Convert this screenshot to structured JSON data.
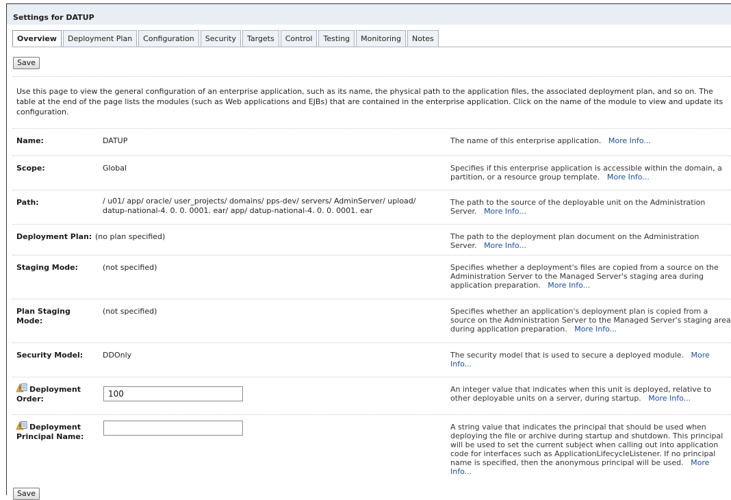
{
  "page": {
    "title": "Settings for DATUP",
    "tabs": [
      {
        "label": "Overview",
        "active": true
      },
      {
        "label": "Deployment Plan"
      },
      {
        "label": "Configuration"
      },
      {
        "label": "Security"
      },
      {
        "label": "Targets"
      },
      {
        "label": "Control"
      },
      {
        "label": "Testing"
      },
      {
        "label": "Monitoring"
      },
      {
        "label": "Notes"
      }
    ],
    "save_label": "Save",
    "intro": "Use this page to view the general configuration of an enterprise application, such as its name, the physical path to the application files, the associated deployment plan, and so on. The table at the end of the page lists the modules (such as Web applications and EJBs) that are contained in the enterprise application. Click on the name of the module to view and update its configuration.",
    "more_info": "More Info...",
    "accent_color": "#1a4f9c",
    "warning_icon": "config-warning-icon"
  },
  "fields": [
    {
      "label": "Name:",
      "value": "DATUP",
      "help": "The name of this enterprise application."
    },
    {
      "label": "Scope:",
      "value": "Global",
      "help": "Specifies if this enterprise application is accessible within the domain, a partition, or a resource group template."
    },
    {
      "label": "Path:",
      "value": "/ u01/ app/ oracle/ user_projects/ domains/ pps-dev/ servers/ AdminServer/ upload/ datup-national-4. 0. 0. 0001. ear/ app/ datup-national-4. 0. 0. 0001. ear",
      "help": "The path to the source of the deployable unit on the Administration Server."
    },
    {
      "label": "Deployment Plan:",
      "value": "(no plan specified)",
      "help": "The path to the deployment plan document on the Administration Server."
    },
    {
      "label": "Staging Mode:",
      "value": "(not specified)",
      "help": "Specifies whether a deployment's files are copied from a source on the Administration Server to the Managed Server's staging area during application preparation."
    },
    {
      "label": "Plan Staging Mode:",
      "value": "(not specified)",
      "help": "Specifies whether an application's deployment plan is copied from a source on the Administration Server to the Managed Server's staging area during application preparation."
    },
    {
      "label": "Security Model:",
      "value": "DDOnly",
      "help": "The security model that is used to secure a deployed module."
    },
    {
      "label": "Deployment Order:",
      "value": "100",
      "help": "An integer value that indicates when this unit is deployed, relative to other deployable units on a server, during startup."
    },
    {
      "label": "Deployment Principal Name:",
      "value": "",
      "help": "A string value that indicates the principal that should be used when deploying the file or archive during startup and shutdown. This principal will be used to set the current subject when calling out into application code for interfaces such as ApplicationLifecycleListener. If no principal name is specified, then the anonymous principal will be used."
    }
  ]
}
